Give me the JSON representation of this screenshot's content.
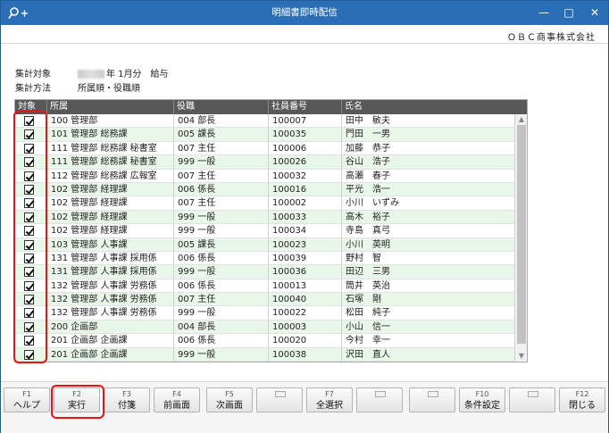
{
  "window": {
    "title": "明細書即時配信",
    "minimize": "—",
    "maximize": "□",
    "close": "✕"
  },
  "company": "ＯＢＣ商事株式会社",
  "info": {
    "target_label": "集計対象",
    "target_value": "年 1月分　給与",
    "method_label": "集計方法",
    "method_value": "所属順・役職順"
  },
  "table": {
    "headers": [
      "対象",
      "所属",
      "役職",
      "社員番号",
      "氏名"
    ],
    "rows": [
      [
        "100 管理部",
        "004 部長",
        "100007",
        "田中　敏夫"
      ],
      [
        "101 管理部 総務課",
        "005 課長",
        "100035",
        "門田　一男"
      ],
      [
        "111 管理部 総務課 秘書室",
        "007 主任",
        "100006",
        "加藤　恭子"
      ],
      [
        "111 管理部 総務課 秘書室",
        "999 一般",
        "100026",
        "谷山　浩子"
      ],
      [
        "112 管理部 総務課 広報室",
        "007 主任",
        "100032",
        "高瀬　春子"
      ],
      [
        "102 管理部 経理課",
        "006 係長",
        "100016",
        "平光　浩一"
      ],
      [
        "102 管理部 経理課",
        "007 主任",
        "100002",
        "小川　いずみ"
      ],
      [
        "102 管理部 経理課",
        "999 一般",
        "100033",
        "高木　裕子"
      ],
      [
        "102 管理部 経理課",
        "999 一般",
        "100034",
        "寺島　真弓"
      ],
      [
        "103 管理部 人事課",
        "005 課長",
        "100023",
        "小川　英明"
      ],
      [
        "131 管理部 人事課 採用係",
        "006 係長",
        "100039",
        "野村　智"
      ],
      [
        "131 管理部 人事課 採用係",
        "999 一般",
        "100036",
        "田辺　三男"
      ],
      [
        "132 管理部 人事課 労務係",
        "006 係長",
        "100013",
        "筒井　英治"
      ],
      [
        "132 管理部 人事課 労務係",
        "007 主任",
        "100040",
        "石塚　剛"
      ],
      [
        "132 管理部 人事課 労務係",
        "999 一般",
        "100022",
        "松田　純子"
      ],
      [
        "200 企画部",
        "004 部長",
        "100003",
        "小山　信一"
      ],
      [
        "201 企画部 企画課",
        "006 係長",
        "100020",
        "今村　幸一"
      ],
      [
        "201 企画部 企画課",
        "999 一般",
        "100038",
        "沢田　直人"
      ]
    ]
  },
  "fkeys": [
    {
      "fn": "F1",
      "label": "ヘルプ"
    },
    {
      "fn": "F2",
      "label": "実行"
    },
    {
      "fn": "F3",
      "label": "付箋"
    },
    {
      "fn": "F4",
      "label": "前画面"
    },
    {
      "fn": "F5",
      "label": "次画面"
    },
    {
      "fn": "",
      "label": ""
    },
    {
      "fn": "F7",
      "label": "全選択"
    },
    {
      "fn": "",
      "label": ""
    },
    {
      "fn": "",
      "label": ""
    },
    {
      "fn": "F10",
      "label": "条件設定"
    },
    {
      "fn": "",
      "label": ""
    },
    {
      "fn": "F12",
      "label": "閉じる"
    }
  ],
  "colors": {
    "titlebar": "#2a6fb5",
    "header": "#585858",
    "alt_row": "#e9f7e9",
    "highlight": "#e11111"
  }
}
